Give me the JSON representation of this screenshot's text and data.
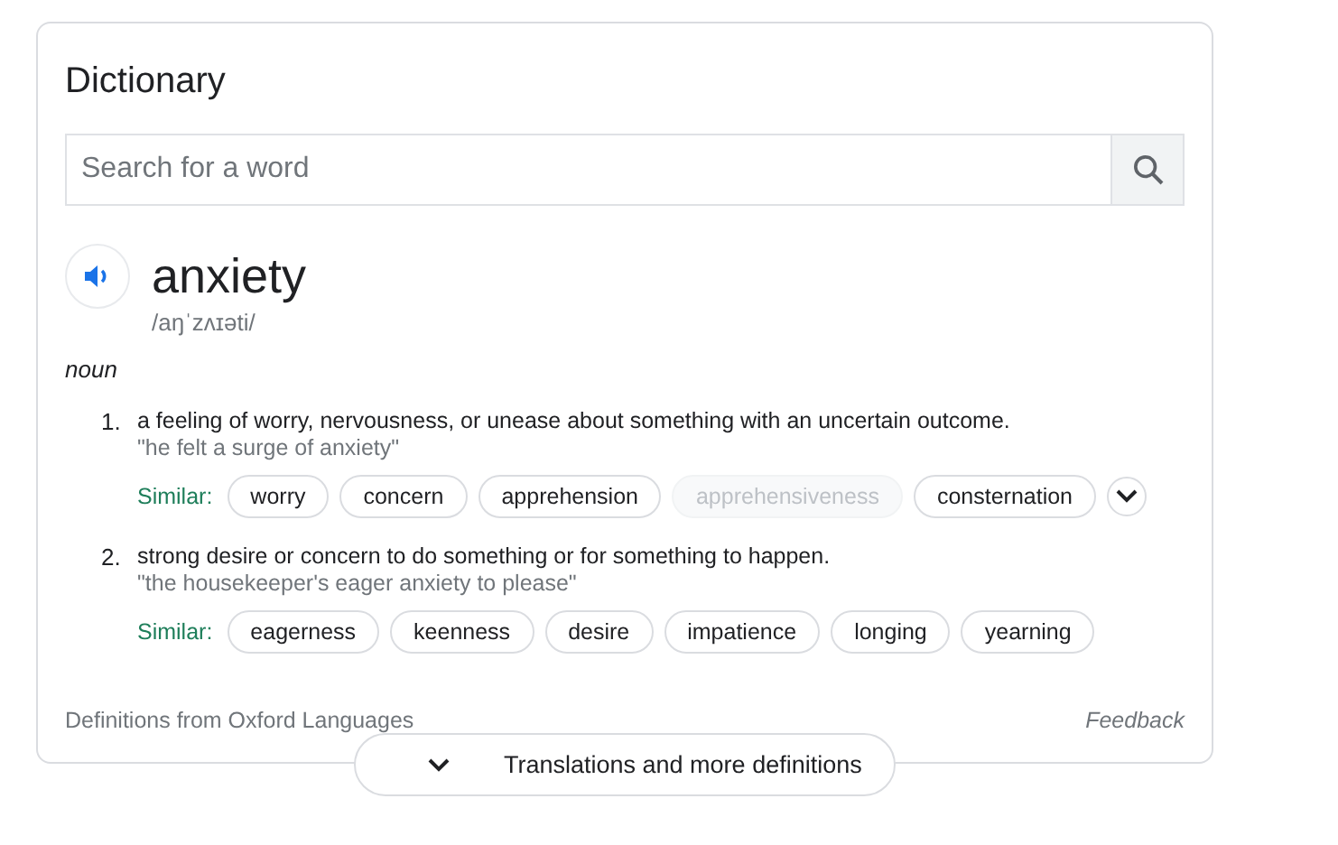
{
  "title": "Dictionary",
  "search": {
    "placeholder": "Search for a word"
  },
  "entry": {
    "word": "anxiety",
    "pronunciation": "/aŋˈzʌɪəti/",
    "part_of_speech": "noun"
  },
  "senses": [
    {
      "number": "1.",
      "definition": "a feeling of worry, nervousness, or unease about something with an uncertain outcome.",
      "example": "\"he felt a surge of anxiety\"",
      "similar_label": "Similar:",
      "similar": [
        {
          "text": "worry",
          "disabled": false
        },
        {
          "text": "concern",
          "disabled": false
        },
        {
          "text": "apprehension",
          "disabled": false
        },
        {
          "text": "apprehensiveness",
          "disabled": true
        },
        {
          "text": "consternation",
          "disabled": false
        }
      ],
      "more": true
    },
    {
      "number": "2.",
      "definition": "strong desire or concern to do something or for something to happen.",
      "example": "\"the housekeeper's eager anxiety to please\"",
      "similar_label": "Similar:",
      "similar": [
        {
          "text": "eagerness",
          "disabled": false
        },
        {
          "text": "keenness",
          "disabled": false
        },
        {
          "text": "desire",
          "disabled": false
        },
        {
          "text": "impatience",
          "disabled": false
        },
        {
          "text": "longing",
          "disabled": false
        },
        {
          "text": "yearning",
          "disabled": false
        }
      ],
      "more": false
    }
  ],
  "source": "Definitions from Oxford Languages",
  "feedback": "Feedback",
  "expand_button": "Translations and more definitions"
}
